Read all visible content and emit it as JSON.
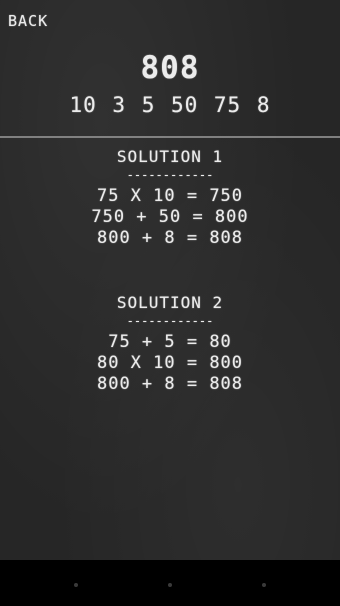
{
  "header": {
    "back_label": "BACK",
    "target": "808",
    "numbers": "10 3 5 50 75 8"
  },
  "solutions": [
    {
      "title": "SOLUTION 1",
      "rule": "------------",
      "steps": [
        "75 X 10 = 750",
        "750 + 50 = 800",
        "800 + 8 = 808"
      ]
    },
    {
      "title": "SOLUTION 2",
      "rule": "------------",
      "steps": [
        "75 + 5 = 80",
        "80 X 10 = 800",
        "800 + 8 = 808"
      ]
    }
  ],
  "nav_bar": {
    "icons": [
      "back-icon",
      "home-icon",
      "recent-apps-icon"
    ]
  },
  "colors": {
    "chalkboard": "#262626",
    "chalk": "#ececec",
    "nav_bar": "#000000"
  }
}
